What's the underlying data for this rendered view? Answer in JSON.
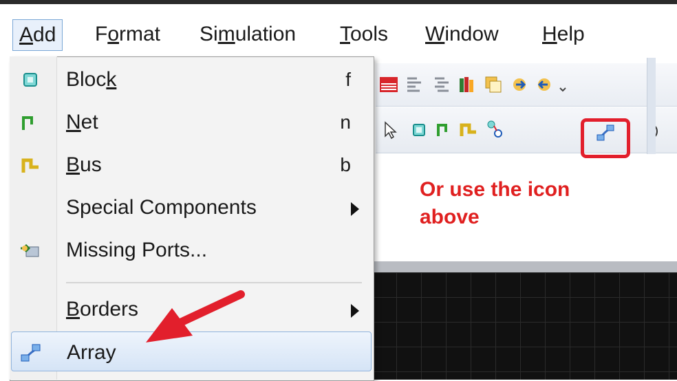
{
  "menubar": {
    "items": [
      {
        "pre": "",
        "u": "A",
        "post": "dd"
      },
      {
        "pre": "F",
        "u": "o",
        "post": "rmat"
      },
      {
        "pre": "Si",
        "u": "m",
        "post": "ulation"
      },
      {
        "pre": "",
        "u": "T",
        "post": "ools"
      },
      {
        "pre": "",
        "u": "W",
        "post": "indow"
      },
      {
        "pre": "",
        "u": "H",
        "post": "elp"
      }
    ]
  },
  "dropdown": {
    "items": [
      {
        "pre": "Bloc",
        "u": "k",
        "post": "",
        "shortcut": "f",
        "icon": "block-icon"
      },
      {
        "pre": "",
        "u": "N",
        "post": "et",
        "shortcut": "n",
        "icon": "net-icon"
      },
      {
        "pre": "",
        "u": "B",
        "post": "us",
        "shortcut": "b",
        "icon": "bus-icon"
      },
      {
        "label": "Special Components",
        "submenu": true
      },
      {
        "label": "Missing Ports...",
        "icon": "missing-ports-icon"
      },
      {
        "pre": "",
        "u": "B",
        "post": "orders",
        "submenu": true
      },
      {
        "label": "Array",
        "icon": "array-icon",
        "highlighted": true
      }
    ]
  },
  "annotation": {
    "line1": "Or use the icon",
    "line2": "above",
    "color": "#e02020"
  },
  "colors": {
    "highlight_border": "#e21f2c",
    "canvas_bg": "#111111"
  }
}
